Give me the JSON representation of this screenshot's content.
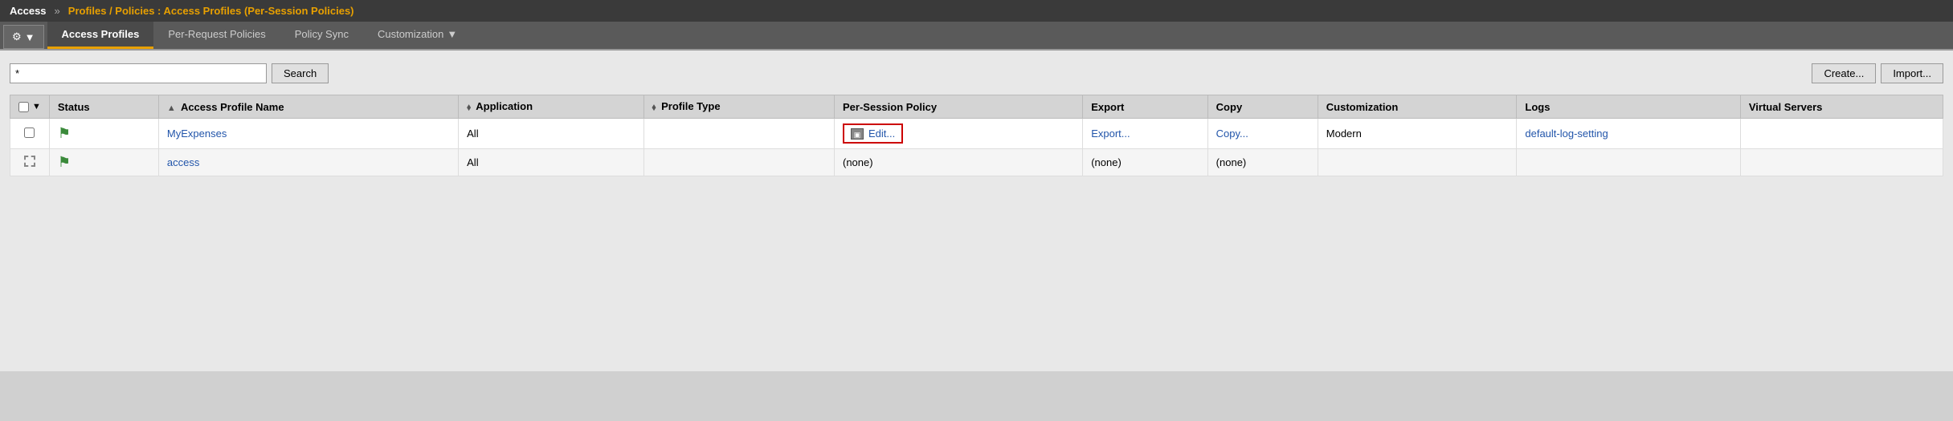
{
  "topbar": {
    "access_label": "Access",
    "chevrons": "»",
    "breadcrumb": "Profiles / Policies : Access Profiles (Per-Session Policies)"
  },
  "tabs": {
    "gear_label": "⚙",
    "gear_dropdown": "▼",
    "items": [
      {
        "id": "access-profiles",
        "label": "Access Profiles",
        "active": true
      },
      {
        "id": "per-request-policies",
        "label": "Per-Request Policies",
        "active": false
      },
      {
        "id": "policy-sync",
        "label": "Policy Sync",
        "active": false
      },
      {
        "id": "customization",
        "label": "Customization",
        "active": false,
        "dropdown": true
      }
    ]
  },
  "search": {
    "input_value": "*",
    "search_label": "Search",
    "create_label": "Create...",
    "import_label": "Import..."
  },
  "table": {
    "columns": [
      {
        "id": "checkbox",
        "label": ""
      },
      {
        "id": "dropdown",
        "label": ""
      },
      {
        "id": "status",
        "label": "Status"
      },
      {
        "id": "name",
        "label": "Access Profile Name",
        "sortable": true
      },
      {
        "id": "application",
        "label": "Application",
        "sortable": true
      },
      {
        "id": "profile-type",
        "label": "Profile Type",
        "sortable": true
      },
      {
        "id": "per-session-policy",
        "label": "Per-Session Policy"
      },
      {
        "id": "export",
        "label": "Export"
      },
      {
        "id": "copy",
        "label": "Copy"
      },
      {
        "id": "customization",
        "label": "Customization"
      },
      {
        "id": "logs",
        "label": "Logs"
      },
      {
        "id": "virtual-servers",
        "label": "Virtual Servers"
      }
    ],
    "rows": [
      {
        "id": "row1",
        "name": "MyExpenses",
        "application": "All",
        "profile_type": "",
        "per_session_policy": "Edit...",
        "per_session_has_border": true,
        "export": "Export...",
        "copy": "Copy...",
        "customization": "Modern",
        "logs": "default-log-setting",
        "virtual_servers": ""
      },
      {
        "id": "row2",
        "name": "access",
        "application": "All",
        "profile_type": "",
        "per_session_policy": "(none)",
        "per_session_has_border": false,
        "export": "(none)",
        "copy": "(none)",
        "customization": "",
        "logs": "",
        "virtual_servers": ""
      }
    ]
  }
}
